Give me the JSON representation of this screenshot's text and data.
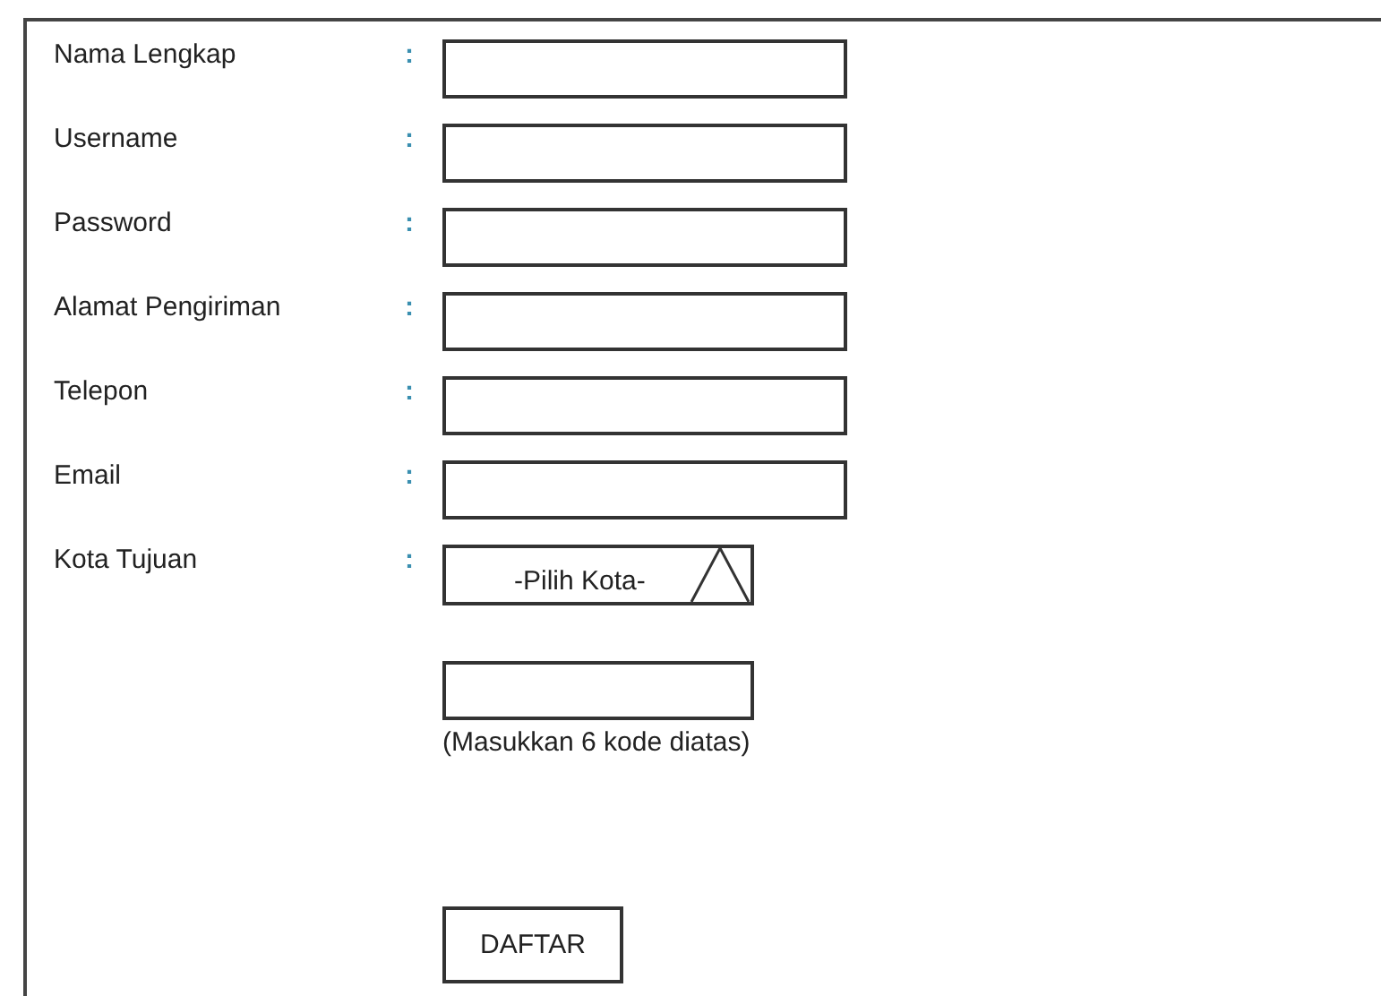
{
  "form": {
    "fields": [
      {
        "label": "Nama Lengkap",
        "separator": ":",
        "kind": "text"
      },
      {
        "label": "Username",
        "separator": ":",
        "kind": "text"
      },
      {
        "label": "Password",
        "separator": ":",
        "kind": "text"
      },
      {
        "label": "Alamat Pengiriman",
        "separator": ":",
        "kind": "text"
      },
      {
        "label": "Telepon",
        "separator": ":",
        "kind": "text"
      },
      {
        "label": "Email",
        "separator": ":",
        "kind": "text"
      },
      {
        "label": "Kota Tujuan",
        "separator": ":",
        "kind": "select",
        "value": "-Pilih Kota-"
      }
    ],
    "captcha": {
      "hint": "(Masukkan 6 kode diatas)"
    },
    "submit": {
      "label": "DAFTAR"
    }
  }
}
